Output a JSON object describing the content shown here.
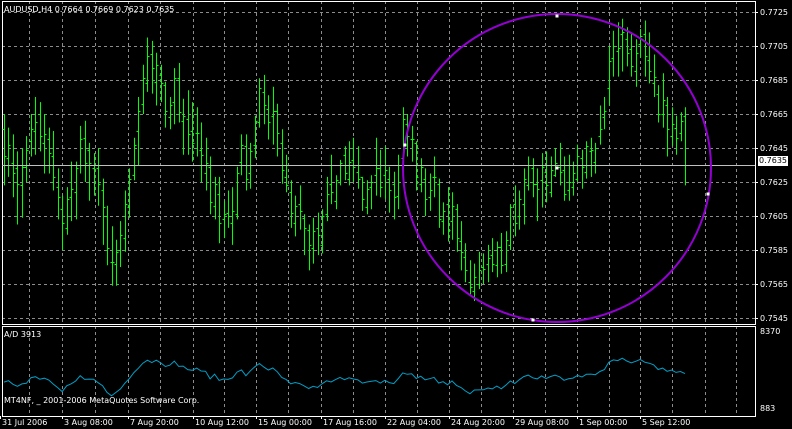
{
  "symbol_header": {
    "symbol_tf": "AUDUSD,H4",
    "ohlc": "0.7664 0.7669 0.7623 0.7635"
  },
  "current_price_label": "0.7635",
  "indicator": {
    "name_value": "A/D 3913",
    "axis_top": "8370",
    "axis_bottom": "883",
    "watermark": "MT4NF, _ 2001-2006 MetaQuotes Software Corp."
  },
  "colors": {
    "background": "#000000",
    "grid": "#8c8c8c",
    "bars": "#00ff00",
    "indicator_line": "#00a0c8",
    "circle": "#9400d3",
    "price_line": "#c0c0c0"
  },
  "chart_data": [
    {
      "type": "ohlc-bar",
      "title": "AUDUSD,H4",
      "ylim": [
        0.754,
        0.773
      ],
      "y_ticks": [
        "0.7725",
        "0.7705",
        "0.7685",
        "0.7665",
        "0.7645",
        "0.7625",
        "0.7605",
        "0.7585",
        "0.7565",
        "0.7545"
      ],
      "x_ticks": [
        "31 Jul 2006",
        "3 Aug 08:00",
        "7 Aug 20:00",
        "10 Aug 12:00",
        "15 Aug 00:00",
        "17 Aug 16:00",
        "22 Aug 04:00",
        "24 Aug 20:00",
        "29 Aug 08:00",
        "1 Sep 00:00",
        "5 Sep 12:00"
      ],
      "current_price": 0.7635,
      "grid": true,
      "bars": [
        [
          0.7656,
          0.7665,
          0.7623,
          0.764
        ],
        [
          0.7639,
          0.7657,
          0.7628,
          0.7647
        ],
        [
          0.7636,
          0.7653,
          0.7616,
          0.763
        ],
        [
          0.7633,
          0.7643,
          0.76,
          0.7624
        ],
        [
          0.7623,
          0.7645,
          0.7604,
          0.7634
        ],
        [
          0.7634,
          0.7652,
          0.7625,
          0.7644
        ],
        [
          0.7649,
          0.7665,
          0.764,
          0.7656
        ],
        [
          0.7655,
          0.7675,
          0.7641,
          0.766
        ],
        [
          0.7665,
          0.7672,
          0.7643,
          0.7652
        ],
        [
          0.7648,
          0.7665,
          0.763,
          0.7653
        ],
        [
          0.765,
          0.7657,
          0.763,
          0.7642
        ],
        [
          0.764,
          0.7655,
          0.762,
          0.7628
        ],
        [
          0.7622,
          0.7633,
          0.7603,
          0.7616
        ],
        [
          0.7609,
          0.7617,
          0.7585,
          0.7601
        ],
        [
          0.7598,
          0.7622,
          0.7594,
          0.7615
        ],
        [
          0.7616,
          0.7637,
          0.7602,
          0.7621
        ],
        [
          0.7619,
          0.7637,
          0.7603,
          0.7633
        ],
        [
          0.7635,
          0.7658,
          0.763,
          0.765
        ],
        [
          0.7651,
          0.7661,
          0.7625,
          0.7636
        ],
        [
          0.7644,
          0.7648,
          0.7614,
          0.7636
        ],
        [
          0.7633,
          0.7642,
          0.7617,
          0.7635
        ],
        [
          0.7633,
          0.7645,
          0.7611,
          0.7624
        ],
        [
          0.762,
          0.7627,
          0.7588,
          0.761
        ],
        [
          0.7605,
          0.7611,
          0.7576,
          0.7586
        ],
        [
          0.7578,
          0.7599,
          0.7564,
          0.7578
        ],
        [
          0.7577,
          0.7591,
          0.7564,
          0.7584
        ],
        [
          0.7585,
          0.7602,
          0.7575,
          0.7594
        ],
        [
          0.7592,
          0.762,
          0.7584,
          0.7612
        ],
        [
          0.761,
          0.7633,
          0.7604,
          0.7627
        ],
        [
          0.7629,
          0.7651,
          0.7626,
          0.7647
        ],
        [
          0.7655,
          0.7675,
          0.7635,
          0.7667
        ],
        [
          0.7671,
          0.7694,
          0.7665,
          0.7686
        ],
        [
          0.7683,
          0.771,
          0.7678,
          0.7699
        ],
        [
          0.77,
          0.7708,
          0.7677,
          0.7692
        ],
        [
          0.7684,
          0.7701,
          0.767,
          0.7694
        ],
        [
          0.7688,
          0.7694,
          0.7672,
          0.7683
        ],
        [
          0.7682,
          0.7684,
          0.7657,
          0.7667
        ],
        [
          0.7663,
          0.7675,
          0.7656,
          0.767
        ],
        [
          0.7672,
          0.7692,
          0.7659,
          0.7686
        ],
        [
          0.7686,
          0.7695,
          0.766,
          0.7666
        ],
        [
          0.7661,
          0.7674,
          0.7641,
          0.7664
        ],
        [
          0.7662,
          0.7679,
          0.7641,
          0.7653
        ],
        [
          0.7655,
          0.7672,
          0.7637,
          0.7648
        ],
        [
          0.7654,
          0.7669,
          0.764,
          0.7654
        ],
        [
          0.7644,
          0.766,
          0.7625,
          0.7641
        ],
        [
          0.763,
          0.7651,
          0.762,
          0.7636
        ],
        [
          0.7634,
          0.764,
          0.7606,
          0.7613
        ],
        [
          0.7611,
          0.7628,
          0.7603,
          0.7624
        ],
        [
          0.7618,
          0.7628,
          0.7589,
          0.7601
        ],
        [
          0.7603,
          0.7614,
          0.7592,
          0.7606
        ],
        [
          0.7607,
          0.762,
          0.7598,
          0.7605
        ],
        [
          0.7601,
          0.7622,
          0.7588,
          0.7608
        ],
        [
          0.7606,
          0.7634,
          0.7603,
          0.763
        ],
        [
          0.7637,
          0.7653,
          0.7629,
          0.7647
        ],
        [
          0.7646,
          0.7653,
          0.762,
          0.7627
        ],
        [
          0.763,
          0.7648,
          0.7621,
          0.7643
        ],
        [
          0.7647,
          0.7664,
          0.7639,
          0.7661
        ],
        [
          0.766,
          0.7686,
          0.7657,
          0.768
        ],
        [
          0.7678,
          0.7688,
          0.7659,
          0.767
        ],
        [
          0.7668,
          0.7676,
          0.765,
          0.766
        ],
        [
          0.7664,
          0.7681,
          0.7647,
          0.7667
        ],
        [
          0.7667,
          0.7671,
          0.764,
          0.7654
        ],
        [
          0.7648,
          0.7656,
          0.7624,
          0.7632
        ],
        [
          0.7628,
          0.7641,
          0.7619,
          0.7623
        ],
        [
          0.7619,
          0.7626,
          0.7598,
          0.7607
        ],
        [
          0.7601,
          0.7617,
          0.7593,
          0.7611
        ],
        [
          0.7612,
          0.7623,
          0.7597,
          0.7608
        ],
        [
          0.7604,
          0.7606,
          0.7582,
          0.7598
        ],
        [
          0.7597,
          0.76,
          0.7573,
          0.7588
        ],
        [
          0.7586,
          0.7604,
          0.7577,
          0.7596
        ],
        [
          0.7598,
          0.7607,
          0.7582,
          0.7594
        ],
        [
          0.7588,
          0.7609,
          0.7583,
          0.7605
        ],
        [
          0.7606,
          0.7628,
          0.7602,
          0.7618
        ],
        [
          0.7624,
          0.7641,
          0.7612,
          0.7619
        ],
        [
          0.7614,
          0.7629,
          0.7609,
          0.7626
        ],
        [
          0.7625,
          0.7638,
          0.7623,
          0.7636
        ],
        [
          0.7641,
          0.7646,
          0.7626,
          0.763
        ],
        [
          0.7627,
          0.7649,
          0.7623,
          0.7637
        ],
        [
          0.7638,
          0.7651,
          0.7625,
          0.7634
        ],
        [
          0.7631,
          0.7646,
          0.7621,
          0.7627
        ],
        [
          0.7628,
          0.7628,
          0.7608,
          0.7615
        ],
        [
          0.761,
          0.7626,
          0.7606,
          0.7621
        ],
        [
          0.7622,
          0.7629,
          0.7609,
          0.7625
        ],
        [
          0.7629,
          0.7651,
          0.7617,
          0.7633
        ],
        [
          0.7633,
          0.7644,
          0.7616,
          0.7622
        ],
        [
          0.7629,
          0.7646,
          0.7615,
          0.7632
        ],
        [
          0.7627,
          0.7634,
          0.7607,
          0.762
        ],
        [
          0.7624,
          0.7631,
          0.7603,
          0.7616
        ],
        [
          0.7617,
          0.7641,
          0.7609,
          0.7635
        ],
        [
          0.7639,
          0.7669,
          0.7631,
          0.7662
        ],
        [
          0.7659,
          0.7665,
          0.764,
          0.7652
        ],
        [
          0.765,
          0.7658,
          0.7637,
          0.765
        ],
        [
          0.7648,
          0.7649,
          0.762,
          0.7628
        ],
        [
          0.7624,
          0.7639,
          0.7619,
          0.7634
        ],
        [
          0.7627,
          0.7633,
          0.7605,
          0.7615
        ],
        [
          0.7616,
          0.763,
          0.7608,
          0.762
        ],
        [
          0.7628,
          0.764,
          0.7616,
          0.7628
        ],
        [
          0.7624,
          0.7627,
          0.7598,
          0.7603
        ],
        [
          0.7602,
          0.7613,
          0.7594,
          0.7608
        ],
        [
          0.7612,
          0.7622,
          0.759,
          0.7597
        ],
        [
          0.7602,
          0.7619,
          0.7591,
          0.7611
        ],
        [
          0.7609,
          0.7612,
          0.7584,
          0.7592
        ],
        [
          0.759,
          0.7602,
          0.7573,
          0.7584
        ],
        [
          0.7581,
          0.7589,
          0.7566,
          0.7573
        ],
        [
          0.7566,
          0.7579,
          0.7559,
          0.7563
        ],
        [
          0.7561,
          0.7577,
          0.7555,
          0.7569
        ],
        [
          0.7565,
          0.7584,
          0.7562,
          0.7573
        ],
        [
          0.7575,
          0.7583,
          0.7565,
          0.7574
        ],
        [
          0.7577,
          0.7588,
          0.7566,
          0.758
        ],
        [
          0.7582,
          0.7592,
          0.7572,
          0.7577
        ],
        [
          0.7576,
          0.759,
          0.7569,
          0.7587
        ],
        [
          0.7587,
          0.7595,
          0.7571,
          0.7576
        ],
        [
          0.7577,
          0.7596,
          0.7572,
          0.7591
        ],
        [
          0.7588,
          0.7612,
          0.7585,
          0.761
        ],
        [
          0.7612,
          0.7623,
          0.7593,
          0.7601
        ],
        [
          0.7605,
          0.762,
          0.7597,
          0.7615
        ],
        [
          0.7612,
          0.7633,
          0.76,
          0.7627
        ],
        [
          0.7623,
          0.764,
          0.762,
          0.7635
        ],
        [
          0.7633,
          0.7639,
          0.7616,
          0.7624
        ],
        [
          0.7624,
          0.7633,
          0.7602,
          0.7621
        ],
        [
          0.7626,
          0.7642,
          0.761,
          0.7634
        ],
        [
          0.7631,
          0.7643,
          0.7613,
          0.7623
        ],
        [
          0.7619,
          0.764,
          0.7616,
          0.7632
        ],
        [
          0.7629,
          0.7645,
          0.7628,
          0.7636
        ],
        [
          0.7634,
          0.7648,
          0.7623,
          0.7631
        ],
        [
          0.7632,
          0.764,
          0.7614,
          0.7618
        ],
        [
          0.762,
          0.7641,
          0.7614,
          0.7625
        ],
        [
          0.7622,
          0.7637,
          0.7617,
          0.763
        ],
        [
          0.7627,
          0.7647,
          0.7625,
          0.764
        ],
        [
          0.7639,
          0.7644,
          0.7621,
          0.7634
        ],
        [
          0.7631,
          0.7649,
          0.7627,
          0.7646
        ],
        [
          0.7643,
          0.7651,
          0.7628,
          0.7644
        ],
        [
          0.7637,
          0.7648,
          0.763,
          0.7645
        ],
        [
          0.7652,
          0.767,
          0.7647,
          0.7656
        ],
        [
          0.7663,
          0.7675,
          0.7656,
          0.7667
        ],
        [
          0.768,
          0.7705,
          0.767,
          0.7696
        ],
        [
          0.7698,
          0.7714,
          0.7687,
          0.7705
        ],
        [
          0.7702,
          0.7719,
          0.7687,
          0.7704
        ],
        [
          0.7712,
          0.7721,
          0.769,
          0.7713
        ],
        [
          0.7709,
          0.7716,
          0.7693,
          0.7701
        ],
        [
          0.7703,
          0.7713,
          0.7687,
          0.7693
        ],
        [
          0.769,
          0.7709,
          0.7681,
          0.7701
        ],
        [
          0.7706,
          0.7715,
          0.7698,
          0.7711
        ],
        [
          0.7712,
          0.772,
          0.7687,
          0.7699
        ],
        [
          0.7697,
          0.7713,
          0.7683,
          0.769
        ],
        [
          0.7683,
          0.77,
          0.7675,
          0.7687
        ],
        [
          0.7677,
          0.7682,
          0.766,
          0.7665
        ],
        [
          0.7665,
          0.7689,
          0.7657,
          0.7673
        ],
        [
          0.767,
          0.7675,
          0.764,
          0.7656
        ],
        [
          0.7652,
          0.7669,
          0.7646,
          0.7659
        ],
        [
          0.7657,
          0.7664,
          0.7641,
          0.7651
        ],
        [
          0.7654,
          0.7666,
          0.7649,
          0.7661
        ],
        [
          0.7664,
          0.7669,
          0.7623,
          0.7635
        ]
      ]
    },
    {
      "type": "line",
      "title": "A/D 3913",
      "ylim": [
        883,
        8370
      ],
      "series": [
        {
          "name": "A/D",
          "values": [
            4870,
            4985,
            4690,
            4527,
            4725,
            4775,
            5232,
            5308,
            5112,
            5191,
            5039,
            4710,
            4404,
            4102,
            4569,
            4733,
            4965,
            5392,
            5088,
            5115,
            5108,
            4821,
            4577,
            4030,
            3758,
            4032,
            4322,
            4794,
            5168,
            5646,
            6005,
            6413,
            6657,
            6458,
            6653,
            6433,
            6145,
            6248,
            6579,
            6153,
            6178,
            5890,
            5834,
            6012,
            5778,
            5750,
            5130,
            5522,
            5014,
            5125,
            5095,
            5211,
            5685,
            5869,
            5391,
            5788,
            6126,
            6389,
            6094,
            5855,
            6018,
            5707,
            5250,
            5077,
            4731,
            4843,
            4752,
            4566,
            4350,
            4526,
            4430,
            4737,
            4978,
            4876,
            5072,
            5252,
            5064,
            5218,
            5127,
            5049,
            4793,
            4878,
            4935,
            4996,
            4793,
            5022,
            4833,
            4751,
            5165,
            5623,
            5509,
            5549,
            5166,
            5356,
            5056,
            5148,
            5251,
            4802,
            4904,
            4660,
            4968,
            4604,
            4429,
            4148,
            3930,
            4228,
            4236,
            4241,
            4389,
            4318,
            4548,
            4326,
            4617,
            4958,
            4756,
            5056,
            5322,
            5444,
            5222,
            5134,
            5380,
            5156,
            5327,
            5431,
            5304,
            5018,
            5144,
            5201,
            5420,
            5287,
            5511,
            5526,
            5471,
            5734,
            5886,
            6494,
            6678,
            6622,
            6819,
            6591,
            6441,
            6562,
            6718,
            6493,
            6414,
            6281,
            5896,
            6015,
            5748,
            5855,
            5658,
            5733,
            5567
          ]
        }
      ]
    }
  ]
}
